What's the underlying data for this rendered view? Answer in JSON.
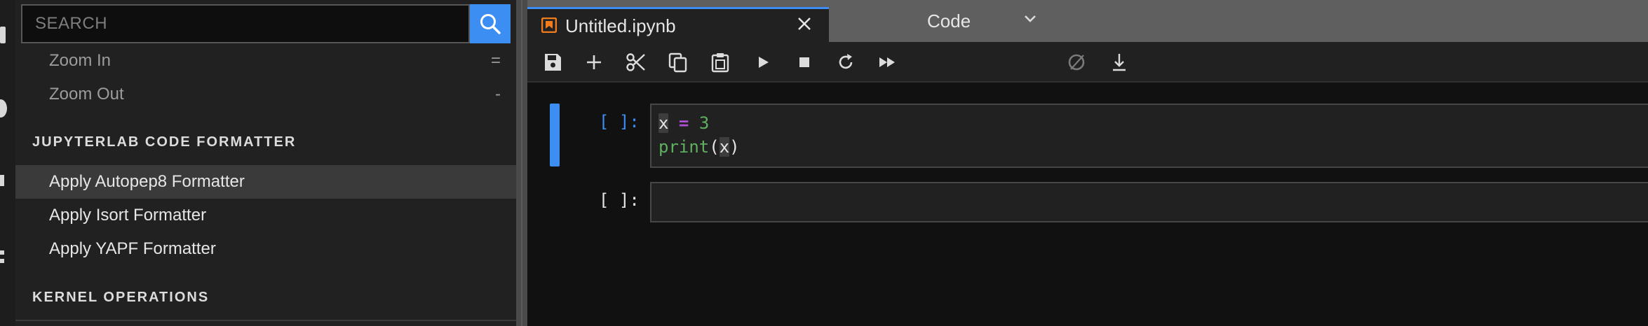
{
  "palette": {
    "search_placeholder": "SEARCH",
    "commands_top": [
      {
        "label": "Zoom In",
        "shortcut": "="
      },
      {
        "label": "Zoom Out",
        "shortcut": "-"
      }
    ],
    "category_formatter": "JUPYTERLAB CODE FORMATTER",
    "formatter_commands": [
      {
        "label": "Apply Autopep8 Formatter"
      },
      {
        "label": "Apply Isort Formatter"
      },
      {
        "label": "Apply YAPF Formatter"
      }
    ],
    "category_kernel": "KERNEL OPERATIONS"
  },
  "tab": {
    "title": "Untitled.ipynb",
    "icon": "notebook-icon"
  },
  "toolbar": {
    "icons": [
      "save-icon",
      "add-cell-icon",
      "cut-icon",
      "copy-icon",
      "paste-icon",
      "run-icon",
      "stop-icon",
      "restart-icon",
      "fast-forward-icon"
    ],
    "cell_type": "Code",
    "right_icons": [
      "kernel-status-icon",
      "download-icon"
    ]
  },
  "cells": [
    {
      "prompt": "[ ]:",
      "code": {
        "l1": {
          "var": "x",
          "sp1": " ",
          "op": "=",
          "sp2": " ",
          "num": "3"
        },
        "l2": {
          "fn": "print",
          "open": "(",
          "arg": "x",
          "close": ")"
        }
      }
    },
    {
      "prompt": "[ ]:"
    }
  ],
  "colors": {
    "accent": "#3c8ef3",
    "keyword_op": "#b14fd9",
    "number_green": "#5fb15f",
    "tab_icon": "#f07c1e"
  }
}
